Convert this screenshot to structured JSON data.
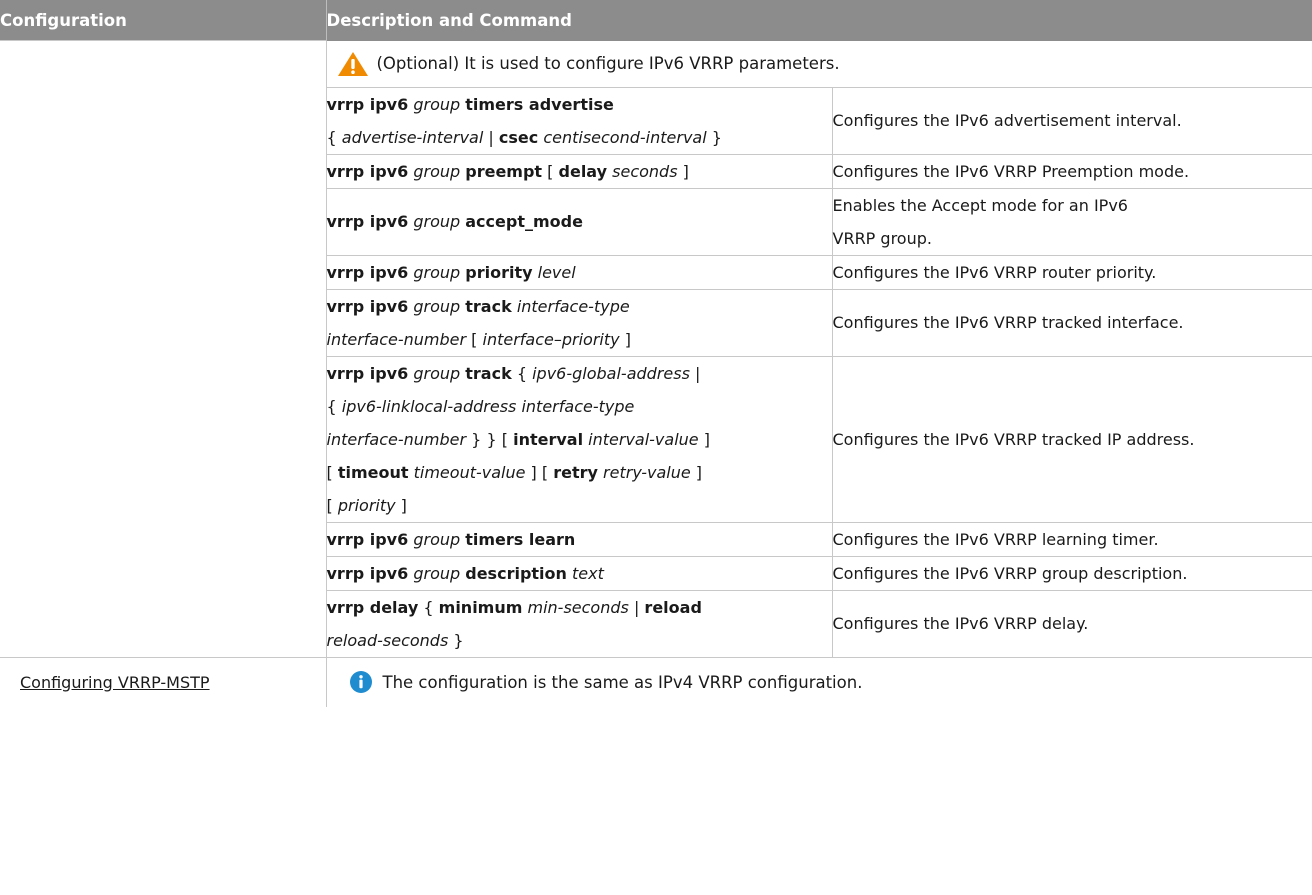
{
  "header": {
    "col_configuration": "Configuration",
    "col_description": "Description and Command"
  },
  "note": {
    "icon": "warning-icon",
    "text": "(Optional) It is used to configure IPv6 VRRP parameters."
  },
  "rows": [
    {
      "description": "Configures the IPv6 advertisement interval."
    },
    {
      "description": "Configures the IPv6 VRRP Preemption mode."
    },
    {
      "description": "Enables the Accept mode for an IPv6 VRRP group."
    },
    {
      "description": "Configures the IPv6 VRRP router priority."
    },
    {
      "description": "Configures the IPv6 VRRP tracked interface."
    },
    {
      "description": "Configures the IPv6 VRRP tracked IP address."
    },
    {
      "description": "Configures the IPv6 VRRP learning timer."
    },
    {
      "description": "Configures the IPv6 VRRP group description."
    },
    {
      "description": "Configures the IPv6 VRRP delay."
    }
  ],
  "cmd": {
    "vrrp_ipv6": "vrrp ipv6",
    "group": "group",
    "timers_advertise": "timers advertise",
    "open_brace": "{",
    "close_brace": "}",
    "open_bracket": "[",
    "close_bracket": "]",
    "pipe": "|",
    "advertise_interval": "advertise-interval",
    "csec": "csec",
    "centisecond_interval": "centisecond-interval",
    "preempt": "preempt",
    "delay_kw": "delay",
    "seconds": "seconds",
    "accept_mode": "accept_mode",
    "priority_kw": "priority",
    "level": "level",
    "track": "track",
    "interface_type": "interface-type",
    "interface_number": "interface-number",
    "interface_priority": "interface–priority",
    "ipv6_global_address": "ipv6-global-address",
    "ipv6_linklocal_address": "ipv6-linklocal-address",
    "interval_kw": "interval",
    "interval_value": "interval-value",
    "timeout_kw": "timeout",
    "timeout_value": "timeout-value",
    "retry_kw": "retry",
    "retry_value": "retry-value",
    "priority_it": "priority",
    "timers_learn": "timers learn",
    "description_kw": "description",
    "text": "text",
    "vrrp_delay": "vrrp delay",
    "minimum": "minimum",
    "min_seconds": "min-seconds",
    "reload": "reload",
    "reload_seconds": "reload-seconds"
  },
  "footer": {
    "link": "Configuring VRRP-MSTP",
    "icon": "info-icon",
    "text": "The configuration is the same as IPv4 VRRP configuration."
  },
  "colors": {
    "header_bg": "#8c8c8c",
    "warning": "#f08a00",
    "info": "#1f8ccf"
  }
}
